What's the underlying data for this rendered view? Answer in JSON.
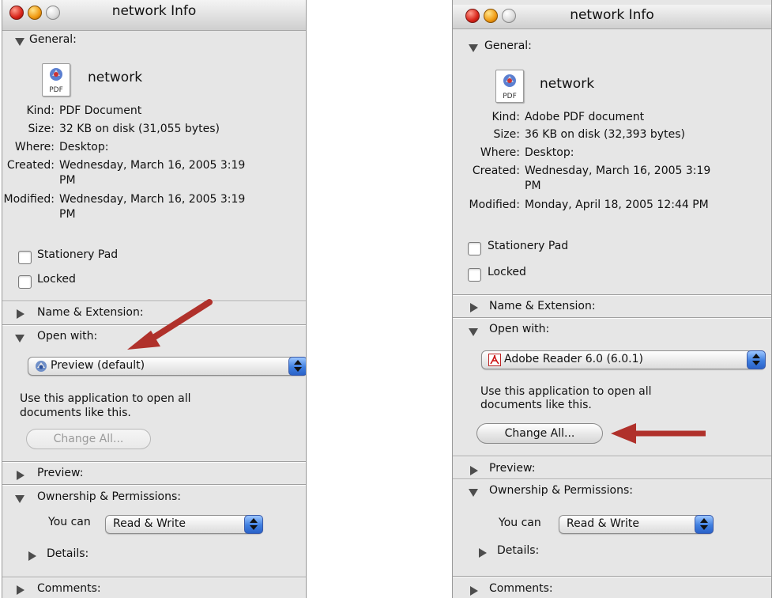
{
  "windows": [
    {
      "title": "network Info",
      "sections": {
        "general": "General:",
        "name_ext": "Name & Extension:",
        "open_with": "Open with:",
        "preview": "Preview:",
        "ownership": "Ownership & Permissions:",
        "details": "Details:",
        "comments": "Comments:"
      },
      "file_name": "network",
      "icon_tag": "PDF",
      "info": {
        "kind_label": "Kind:",
        "kind": "PDF Document",
        "size_label": "Size:",
        "size": "32 KB on disk (31,055 bytes)",
        "where_label": "Where:",
        "where": "Desktop:",
        "created_label": "Created:",
        "created_line1": "Wednesday, March 16, 2005 3:19",
        "created_line2": "PM",
        "modified_label": "Modified:",
        "modified_line1": "Wednesday, March 16, 2005 3:19",
        "modified_line2": "PM"
      },
      "checkboxes": {
        "stationery": "Stationery Pad",
        "locked": "Locked"
      },
      "app": "Preview (default)",
      "use_text_line1": "Use this application to open all",
      "use_text_line2": "documents like this.",
      "change_all": "Change All...",
      "change_all_enabled": false,
      "you_can": "You can",
      "permission": "Read & Write"
    },
    {
      "title": "network Info",
      "sections": {
        "general": "General:",
        "name_ext": "Name & Extension:",
        "open_with": "Open with:",
        "preview": "Preview:",
        "ownership": "Ownership & Permissions:",
        "details": "Details:",
        "comments": "Comments:"
      },
      "file_name": "network",
      "icon_tag": "PDF",
      "info": {
        "kind_label": "Kind:",
        "kind": "Adobe PDF document",
        "size_label": "Size:",
        "size": "36 KB on disk (32,393 bytes)",
        "where_label": "Where:",
        "where": "Desktop:",
        "created_label": "Created:",
        "created_line1": "Wednesday, March 16, 2005 3:19",
        "created_line2": "PM",
        "modified_label": "Modified:",
        "modified_line1": "Monday, April 18, 2005 12:44 PM"
      },
      "checkboxes": {
        "stationery": "Stationery Pad",
        "locked": "Locked"
      },
      "app": "Adobe Reader 6.0 (6.0.1)",
      "use_text_line1": "Use this application to open all",
      "use_text_line2": "documents like this.",
      "change_all": "Change All...",
      "change_all_enabled": true,
      "you_can": "You can",
      "permission": "Read & Write"
    }
  ],
  "colors": {
    "annotation_arrow": "#b0312b",
    "stepper_blue": "#3f7fe0"
  }
}
